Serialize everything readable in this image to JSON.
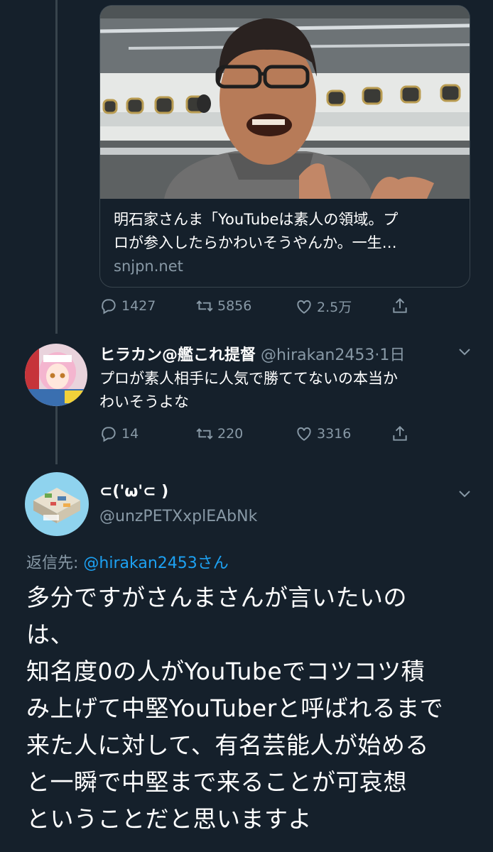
{
  "link_card": {
    "title_line1": "明石家さんま「YouTubeは素人の領域。プ",
    "title_line2": "ロが参入したらかわいそうやんか。一生…",
    "domain": "snjpn.net"
  },
  "tweet1_actions": {
    "replies": "1427",
    "retweets": "5856",
    "likes": "2.5万"
  },
  "reply_tweet": {
    "name": "ヒラカン@艦これ提督",
    "handle": "@hirakan2453",
    "time": "·1日",
    "text_line1": "プロが素人相手に人気で勝ててないの本当か",
    "text_line2": "わいそうよな",
    "actions": {
      "replies": "14",
      "retweets": "220",
      "likes": "3316"
    }
  },
  "main_tweet": {
    "name": "⊂('ω'⊂ )",
    "handle": "@unzPETXxplEAbNk",
    "reply_to_label": "返信先:",
    "reply_to_mention": "@hirakan2453さん",
    "lines": [
      "多分ですがさんまさんが言いたいの",
      "は、",
      "知名度0の人がYouTubeでコツコツ積",
      "み上げて中堅YouTuberと呼ばれるまで",
      "来た人に対して、有名芸能人が始める",
      "と一瞬で中堅まで来ることが可哀想",
      "ということだと思いますよ"
    ]
  },
  "icons": [
    "reply-icon",
    "retweet-icon",
    "like-icon",
    "share-icon",
    "chevron-down-icon"
  ],
  "colors": {
    "background": "#15202b",
    "secondary_text": "#8899a6",
    "link": "#1da1f2",
    "border": "#38444d"
  }
}
